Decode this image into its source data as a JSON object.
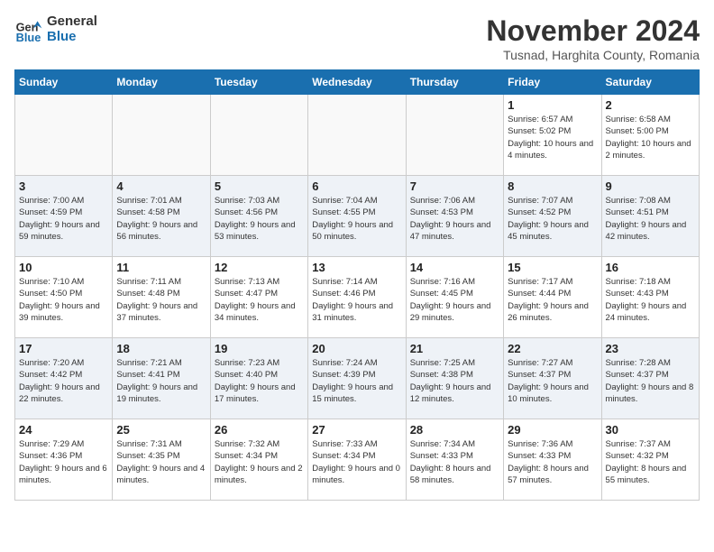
{
  "header": {
    "logo_line1": "General",
    "logo_line2": "Blue",
    "month": "November 2024",
    "location": "Tusnad, Harghita County, Romania"
  },
  "weekdays": [
    "Sunday",
    "Monday",
    "Tuesday",
    "Wednesday",
    "Thursday",
    "Friday",
    "Saturday"
  ],
  "weeks": [
    [
      {
        "day": "",
        "info": ""
      },
      {
        "day": "",
        "info": ""
      },
      {
        "day": "",
        "info": ""
      },
      {
        "day": "",
        "info": ""
      },
      {
        "day": "",
        "info": ""
      },
      {
        "day": "1",
        "info": "Sunrise: 6:57 AM\nSunset: 5:02 PM\nDaylight: 10 hours and 4 minutes."
      },
      {
        "day": "2",
        "info": "Sunrise: 6:58 AM\nSunset: 5:00 PM\nDaylight: 10 hours and 2 minutes."
      }
    ],
    [
      {
        "day": "3",
        "info": "Sunrise: 7:00 AM\nSunset: 4:59 PM\nDaylight: 9 hours and 59 minutes."
      },
      {
        "day": "4",
        "info": "Sunrise: 7:01 AM\nSunset: 4:58 PM\nDaylight: 9 hours and 56 minutes."
      },
      {
        "day": "5",
        "info": "Sunrise: 7:03 AM\nSunset: 4:56 PM\nDaylight: 9 hours and 53 minutes."
      },
      {
        "day": "6",
        "info": "Sunrise: 7:04 AM\nSunset: 4:55 PM\nDaylight: 9 hours and 50 minutes."
      },
      {
        "day": "7",
        "info": "Sunrise: 7:06 AM\nSunset: 4:53 PM\nDaylight: 9 hours and 47 minutes."
      },
      {
        "day": "8",
        "info": "Sunrise: 7:07 AM\nSunset: 4:52 PM\nDaylight: 9 hours and 45 minutes."
      },
      {
        "day": "9",
        "info": "Sunrise: 7:08 AM\nSunset: 4:51 PM\nDaylight: 9 hours and 42 minutes."
      }
    ],
    [
      {
        "day": "10",
        "info": "Sunrise: 7:10 AM\nSunset: 4:50 PM\nDaylight: 9 hours and 39 minutes."
      },
      {
        "day": "11",
        "info": "Sunrise: 7:11 AM\nSunset: 4:48 PM\nDaylight: 9 hours and 37 minutes."
      },
      {
        "day": "12",
        "info": "Sunrise: 7:13 AM\nSunset: 4:47 PM\nDaylight: 9 hours and 34 minutes."
      },
      {
        "day": "13",
        "info": "Sunrise: 7:14 AM\nSunset: 4:46 PM\nDaylight: 9 hours and 31 minutes."
      },
      {
        "day": "14",
        "info": "Sunrise: 7:16 AM\nSunset: 4:45 PM\nDaylight: 9 hours and 29 minutes."
      },
      {
        "day": "15",
        "info": "Sunrise: 7:17 AM\nSunset: 4:44 PM\nDaylight: 9 hours and 26 minutes."
      },
      {
        "day": "16",
        "info": "Sunrise: 7:18 AM\nSunset: 4:43 PM\nDaylight: 9 hours and 24 minutes."
      }
    ],
    [
      {
        "day": "17",
        "info": "Sunrise: 7:20 AM\nSunset: 4:42 PM\nDaylight: 9 hours and 22 minutes."
      },
      {
        "day": "18",
        "info": "Sunrise: 7:21 AM\nSunset: 4:41 PM\nDaylight: 9 hours and 19 minutes."
      },
      {
        "day": "19",
        "info": "Sunrise: 7:23 AM\nSunset: 4:40 PM\nDaylight: 9 hours and 17 minutes."
      },
      {
        "day": "20",
        "info": "Sunrise: 7:24 AM\nSunset: 4:39 PM\nDaylight: 9 hours and 15 minutes."
      },
      {
        "day": "21",
        "info": "Sunrise: 7:25 AM\nSunset: 4:38 PM\nDaylight: 9 hours and 12 minutes."
      },
      {
        "day": "22",
        "info": "Sunrise: 7:27 AM\nSunset: 4:37 PM\nDaylight: 9 hours and 10 minutes."
      },
      {
        "day": "23",
        "info": "Sunrise: 7:28 AM\nSunset: 4:37 PM\nDaylight: 9 hours and 8 minutes."
      }
    ],
    [
      {
        "day": "24",
        "info": "Sunrise: 7:29 AM\nSunset: 4:36 PM\nDaylight: 9 hours and 6 minutes."
      },
      {
        "day": "25",
        "info": "Sunrise: 7:31 AM\nSunset: 4:35 PM\nDaylight: 9 hours and 4 minutes."
      },
      {
        "day": "26",
        "info": "Sunrise: 7:32 AM\nSunset: 4:34 PM\nDaylight: 9 hours and 2 minutes."
      },
      {
        "day": "27",
        "info": "Sunrise: 7:33 AM\nSunset: 4:34 PM\nDaylight: 9 hours and 0 minutes."
      },
      {
        "day": "28",
        "info": "Sunrise: 7:34 AM\nSunset: 4:33 PM\nDaylight: 8 hours and 58 minutes."
      },
      {
        "day": "29",
        "info": "Sunrise: 7:36 AM\nSunset: 4:33 PM\nDaylight: 8 hours and 57 minutes."
      },
      {
        "day": "30",
        "info": "Sunrise: 7:37 AM\nSunset: 4:32 PM\nDaylight: 8 hours and 55 minutes."
      }
    ]
  ]
}
